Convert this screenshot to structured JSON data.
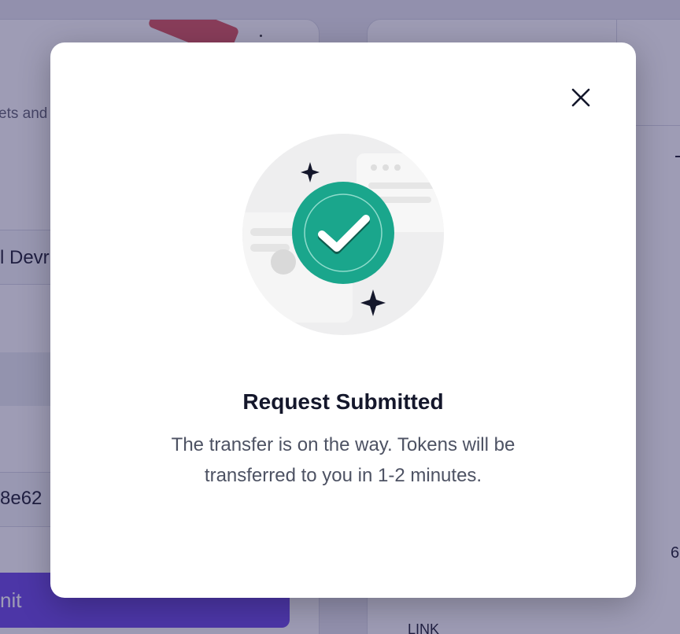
{
  "background": {
    "subtext": "ets and",
    "name_value": "l Devr",
    "address_value": "8e62",
    "submit_label": "nit",
    "right_token": "LINK",
    "right_number": "6"
  },
  "modal": {
    "title": "Request Submitted",
    "message": "The transfer is on the way. Tokens will be transferred to you in 1-2 minutes.",
    "close_icon": "close-icon",
    "illustration_icon": "check-circle-icon"
  },
  "colors": {
    "check_badge": "#1aa68c",
    "submit_button": "#6b46e5",
    "title": "#14172b",
    "body_text": "#4d5263"
  }
}
